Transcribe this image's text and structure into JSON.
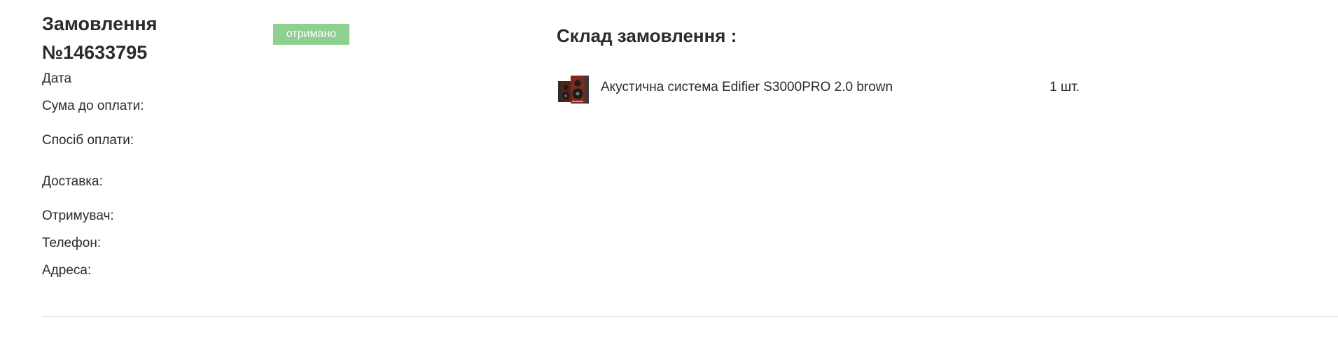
{
  "order": {
    "title_line1": "Замовлення",
    "title_line2": "№14633795",
    "status": "отримано",
    "status_color": "#8fcf8f"
  },
  "fields": {
    "date": "Дата",
    "amount": "Сума до оплати:",
    "payment_method": "Спосіб оплати:",
    "delivery": "Доставка:",
    "recipient": "Отримувач:",
    "phone": "Телефон:",
    "address": "Адреса:"
  },
  "composition": {
    "title": "Склад замовлення :",
    "items": [
      {
        "name": "Акустична система Edifier S3000PRO 2.0 brown",
        "quantity": "1 шт.",
        "image_icon": "speaker-pair-icon"
      }
    ]
  }
}
